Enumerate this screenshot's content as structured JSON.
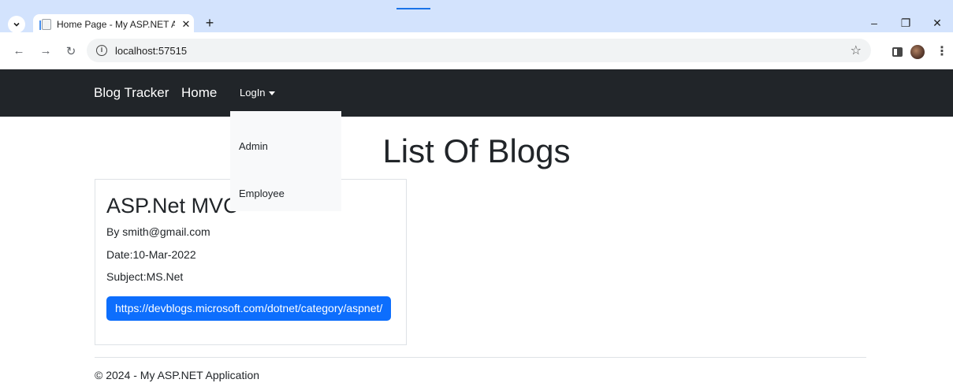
{
  "browser": {
    "tab_title": "Home Page - My ASP.NET Appl",
    "tab_close": "✕",
    "new_tab": "+",
    "url": "localhost:57515",
    "controls": {
      "minimize": "–",
      "restore": "❐",
      "close": "✕"
    }
  },
  "navbar": {
    "brand": "Blog Tracker",
    "home": "Home",
    "login": "LogIn",
    "background": "#212529"
  },
  "dropdown": {
    "items": [
      "Admin",
      "Employee"
    ]
  },
  "main": {
    "title": "List Of Blogs"
  },
  "blogs": [
    {
      "title": "ASP.Net MVC",
      "author": "By smith@gmail.com",
      "date": "Date:10-Mar-2022",
      "subject": "Subject:MS.Net",
      "link": "https://devblogs.microsoft.com/dotnet/category/aspnet/"
    }
  ],
  "footer": {
    "text": "© 2024 - My ASP.NET Application"
  },
  "colors": {
    "primary_button": "#0d6efd",
    "tabstrip": "#d3e3fd"
  }
}
